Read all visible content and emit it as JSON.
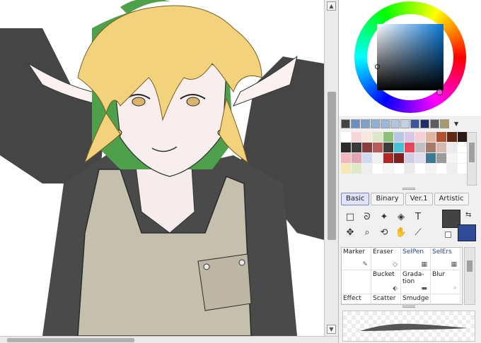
{
  "canvas": {
    "artwork": "illustration-character-apron"
  },
  "colors": {
    "current_main": "#434343",
    "current_sub": "#2f4a99",
    "recent": [
      "#444444",
      "#6b8fc4",
      "#7ea1c9",
      "#8fb0d3",
      "#9db9d9",
      "#b0c6df",
      "#c2d2e6",
      "#3b56a0",
      "#1e2f6a",
      "#5d5d5d",
      "#a89a6a"
    ],
    "palette": [
      "#ffffff",
      "#f6d6d6",
      "#f8e7dc",
      "#dce7c8",
      "#8ec27a",
      "#b9c7e6",
      "#d7c6e4",
      "#f4cfd6",
      "#e0b5a0",
      "#b0522e",
      "#5e2a16",
      "#2b1a14",
      "#2a2a2a",
      "#3a3a3a",
      "#8a3d3d",
      "#b65c5c",
      "#3c3c3c",
      "#47c2d4",
      "#e6455e",
      "#bfbfbf",
      "#a47a6a",
      "#d8b9b0",
      "#ececec",
      "#ffffff",
      "#f2b6bd",
      "#e9a3b6",
      "#cfd9f0",
      "#f1f1f1",
      "#b22626",
      "#7f1f1f",
      "#d3cce6",
      "#e1dbee",
      "#3d7a91",
      "#9b9b9b",
      "#f5f5f5",
      "#ffffff",
      "#f6e6b8",
      "#dcebc6",
      "#eeeeee",
      "#ffffff",
      "#f6f6f6",
      "#ffffff",
      "#ebebeb",
      "#ffffff",
      "#f4f4f4",
      "#ffffff",
      "#efefef",
      "#ffffff"
    ]
  },
  "tool_tabs": [
    "Basic",
    "Binary",
    "Ver.1",
    "Artistic"
  ],
  "tools": [
    "rect-select-icon",
    "lasso-icon",
    "magic-wand-icon",
    "bucket-select-icon",
    "text-icon",
    "move-icon",
    "zoom-icon",
    "rotate-icon",
    "hand-icon",
    "eyedropper-icon"
  ],
  "tool_symbols": [
    "□",
    "ᘐ",
    "✦",
    "◈",
    "T",
    "✥",
    "⌕",
    "⟲",
    "✋",
    "⟋"
  ],
  "brushes": [
    {
      "label": "Marker",
      "icon": "✎",
      "blue": false
    },
    {
      "label": "Eraser",
      "icon": "◇",
      "blue": false
    },
    {
      "label": "SelPen",
      "icon": "▦",
      "blue": true
    },
    {
      "label": "SelErs",
      "icon": "▦",
      "blue": true
    },
    {
      "label": "",
      "icon": "",
      "blue": false
    },
    {
      "label": "Bucket",
      "icon": "⬖",
      "blue": false
    },
    {
      "label": "Grada-\ntion",
      "icon": "▬",
      "blue": false
    },
    {
      "label": "Blur",
      "icon": "◦",
      "blue": false
    },
    {
      "label": "Effect",
      "icon": "",
      "blue": false
    },
    {
      "label": "Scatter",
      "icon": "",
      "blue": false
    },
    {
      "label": "Smudge",
      "icon": "",
      "blue": false
    },
    {
      "label": "",
      "icon": "",
      "blue": false
    }
  ]
}
